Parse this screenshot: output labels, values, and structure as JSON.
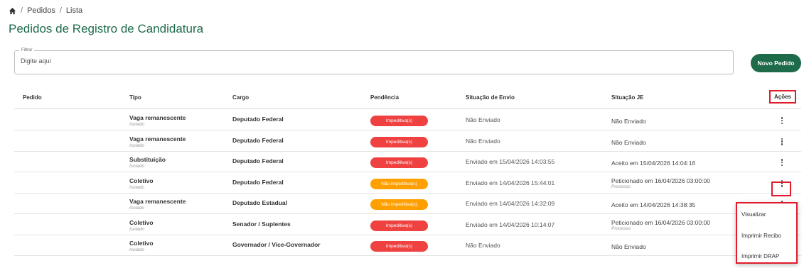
{
  "breadcrumb": {
    "items": [
      "Pedidos",
      "Lista"
    ],
    "separator": "/"
  },
  "page_title": "Pedidos de Registro de Candidatura",
  "filter": {
    "legend": "Filtrar",
    "placeholder": "Digite aqui",
    "value": ""
  },
  "new_button": "Novo Pedido",
  "table": {
    "headers": [
      "Pedido",
      "Tipo",
      "Cargo",
      "Pendência",
      "Situação de Envio",
      "Situação JE",
      "Ações"
    ],
    "rows": [
      {
        "pedido": "",
        "tipo": "Vaga remanescente",
        "tipo_sub": "Isolado",
        "cargo": "Deputado Federal",
        "pendencia": "Impeditiva(s)",
        "pendencia_color": "#f04141",
        "envio": "Não Enviado",
        "je": "Não Enviado",
        "je_sub": ""
      },
      {
        "pedido": "",
        "tipo": "Vaga remanescente",
        "tipo_sub": "Isolado",
        "cargo": "Deputado Federal",
        "pendencia": "Impeditiva(s)",
        "pendencia_color": "#f04141",
        "envio": "Não Enviado",
        "je": "Não Enviado",
        "je_sub": ""
      },
      {
        "pedido": "",
        "tipo": "Substituição",
        "tipo_sub": "Isolado",
        "cargo": "Deputado Federal",
        "pendencia": "Impeditiva(s)",
        "pendencia_color": "#f04141",
        "envio": "Enviado em 15/04/2026 14:03:55",
        "je": "Aceito em 15/04/2026 14:04:16",
        "je_sub": ""
      },
      {
        "pedido": "",
        "tipo": "Coletivo",
        "tipo_sub": "Isolado",
        "cargo": "Deputado Federal",
        "pendencia": "Não impeditiva(s)",
        "pendencia_color": "#ffa000",
        "envio": "Enviado em 14/04/2026 15:44:01",
        "je": "Peticionado em 16/04/2026 03:00:00",
        "je_sub": "Processo"
      },
      {
        "pedido": "",
        "tipo": "Vaga remanescente",
        "tipo_sub": "Isolado",
        "cargo": "Deputado Estadual",
        "pendencia": "Não impeditiva(s)",
        "pendencia_color": "#ffa000",
        "envio": "Enviado em 14/04/2026 14:32:09",
        "je": "Aceito em 14/04/2026 14:38:35",
        "je_sub": ""
      },
      {
        "pedido": "",
        "tipo": "Coletivo",
        "tipo_sub": "Isolado",
        "cargo": "Senador / Suplentes",
        "pendencia": "Impeditiva(s)",
        "pendencia_color": "#f04141",
        "envio": "Enviado em 14/04/2026 10:14:07",
        "je": "Peticionado em 16/04/2026 03:00:00",
        "je_sub": "Processo"
      },
      {
        "pedido": "",
        "tipo": "Coletivo",
        "tipo_sub": "Isolado",
        "cargo": "Governador / Vice-Governador",
        "pendencia": "Impeditiva(s)",
        "pendencia_color": "#f04141",
        "envio": "Não Enviado",
        "je": "Não Enviado",
        "je_sub": ""
      }
    ]
  },
  "actions_menu": {
    "items": [
      "Visualizar",
      "Imprimir Recibo",
      "Imprimir DRAP"
    ]
  },
  "colors": {
    "primary": "#1e6b4a",
    "highlight": "#e01b2c"
  },
  "icons": {
    "home": "home-icon",
    "row_actions": "kebab-menu-icon"
  }
}
